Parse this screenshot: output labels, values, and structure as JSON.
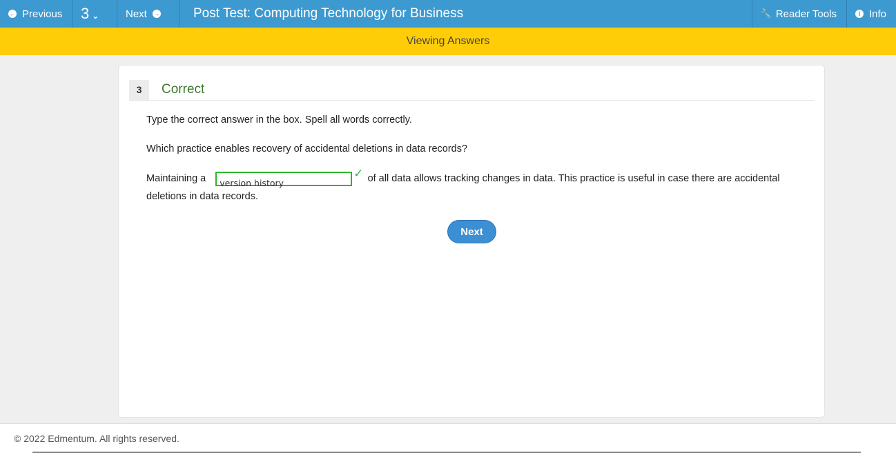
{
  "nav": {
    "previous_label": "Previous",
    "question_number": "3",
    "next_label": "Next",
    "title": "Post Test: Computing Technology for Business",
    "reader_tools_label": "Reader Tools",
    "info_label": "Info"
  },
  "banner": {
    "text": "Viewing Answers"
  },
  "question": {
    "number": "3",
    "status": "Correct",
    "instruction": "Type the correct answer in the box. Spell all words correctly.",
    "prompt": "Which practice enables recovery of accidental deletions in data records?",
    "sentence_before": "Maintaining a",
    "answer_value": "version history",
    "sentence_after": "of all data allows tracking changes in data. This practice is useful in case there are accidental deletions in data records.",
    "next_button_label": "Next"
  },
  "footer": {
    "copyright": "© 2022 Edmentum. All rights reserved."
  },
  "colors": {
    "topbar": "#3d9ad1",
    "banner": "#fecd08",
    "correct_green": "#3b7a2f",
    "answer_border": "#2eb52e",
    "button_blue": "#3d8fd4"
  },
  "icons": [
    "arrow-left-circle-icon",
    "chevron-down-icon",
    "arrow-right-circle-icon",
    "wrench-icon",
    "info-circle-icon",
    "checkmark-icon"
  ]
}
